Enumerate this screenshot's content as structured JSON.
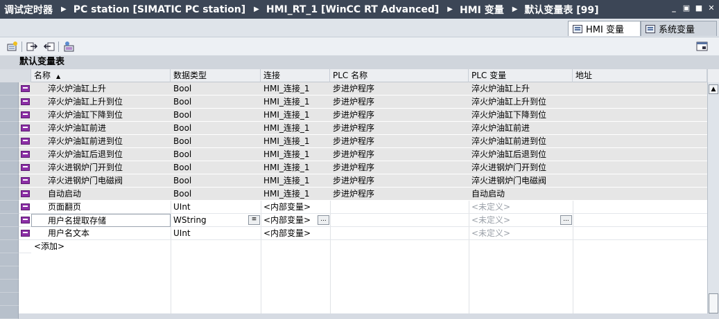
{
  "title": {
    "breadcrumb": [
      "调试定时器",
      "PC station [SIMATIC PC station]",
      "HMI_RT_1 [WinCC RT Advanced]",
      "HMI 变量",
      "默认变量表 [99]"
    ],
    "separator": "▶",
    "window_controls": [
      "_",
      "▣",
      "■",
      "✕"
    ]
  },
  "tabs": [
    {
      "label": "HMI 变量",
      "active": true
    },
    {
      "label": "系统变量",
      "active": false
    }
  ],
  "toolbar": {
    "buttons": [
      "add-tag-icon",
      "export-icon",
      "import-icon",
      "monitor-icon"
    ],
    "right_button": "window-split-icon"
  },
  "table_title": "默认变量表",
  "columns": {
    "name": "名称",
    "sort_indicator": "▲",
    "data_type": "数据类型",
    "connection": "连接",
    "plc_name": "PLC 名称",
    "plc_tag": "PLC 变量",
    "address": "地址"
  },
  "rows": [
    {
      "name": "淬火炉油缸上升",
      "type": "Bool",
      "conn": "HMI_连接_1",
      "plc": "步进炉程序",
      "plc_tag": "淬火炉油缸上升",
      "addr": ""
    },
    {
      "name": "淬火炉油缸上升到位",
      "type": "Bool",
      "conn": "HMI_连接_1",
      "plc": "步进炉程序",
      "plc_tag": "淬火炉油缸上升到位",
      "addr": ""
    },
    {
      "name": "淬火炉油缸下降到位",
      "type": "Bool",
      "conn": "HMI_连接_1",
      "plc": "步进炉程序",
      "plc_tag": "淬火炉油缸下降到位",
      "addr": ""
    },
    {
      "name": "淬火炉油缸前进",
      "type": "Bool",
      "conn": "HMI_连接_1",
      "plc": "步进炉程序",
      "plc_tag": "淬火炉油缸前进",
      "addr": ""
    },
    {
      "name": "淬火炉油缸前进到位",
      "type": "Bool",
      "conn": "HMI_连接_1",
      "plc": "步进炉程序",
      "plc_tag": "淬火炉油缸前进到位",
      "addr": ""
    },
    {
      "name": "淬火炉油缸后退到位",
      "type": "Bool",
      "conn": "HMI_连接_1",
      "plc": "步进炉程序",
      "plc_tag": "淬火炉油缸后退到位",
      "addr": ""
    },
    {
      "name": "淬火进钢炉门开到位",
      "type": "Bool",
      "conn": "HMI_连接_1",
      "plc": "步进炉程序",
      "plc_tag": "淬火进钢炉门开到位",
      "addr": ""
    },
    {
      "name": "淬火进钢炉门电磁阀",
      "type": "Bool",
      "conn": "HMI_连接_1",
      "plc": "步进炉程序",
      "plc_tag": "淬火进钢炉门电磁阀",
      "addr": ""
    },
    {
      "name": "自动启动",
      "type": "Bool",
      "conn": "HMI_连接_1",
      "plc": "步进炉程序",
      "plc_tag": "自动启动",
      "addr": ""
    },
    {
      "name": "页面翻页",
      "type": "UInt",
      "conn": "<内部变量>",
      "plc": "",
      "plc_tag": "<未定义>",
      "addr": ""
    },
    {
      "name": "用户名提取存储",
      "type": "WString",
      "conn": "<内部变量>",
      "plc": "",
      "plc_tag": "<未定义>",
      "addr": ""
    },
    {
      "name": "用户名文本",
      "type": "UInt",
      "conn": "<内部变量>",
      "plc": "",
      "plc_tag": "<未定义>",
      "addr": ""
    }
  ],
  "add_row": "<添加>",
  "browse_button_label": "...",
  "scroll_up": "▲",
  "colors": {
    "titlebar": "#3c4656",
    "tag_icon": "#8c2fa6",
    "gray_row": "#e6e6e6",
    "selector": "#b7c0cb"
  }
}
